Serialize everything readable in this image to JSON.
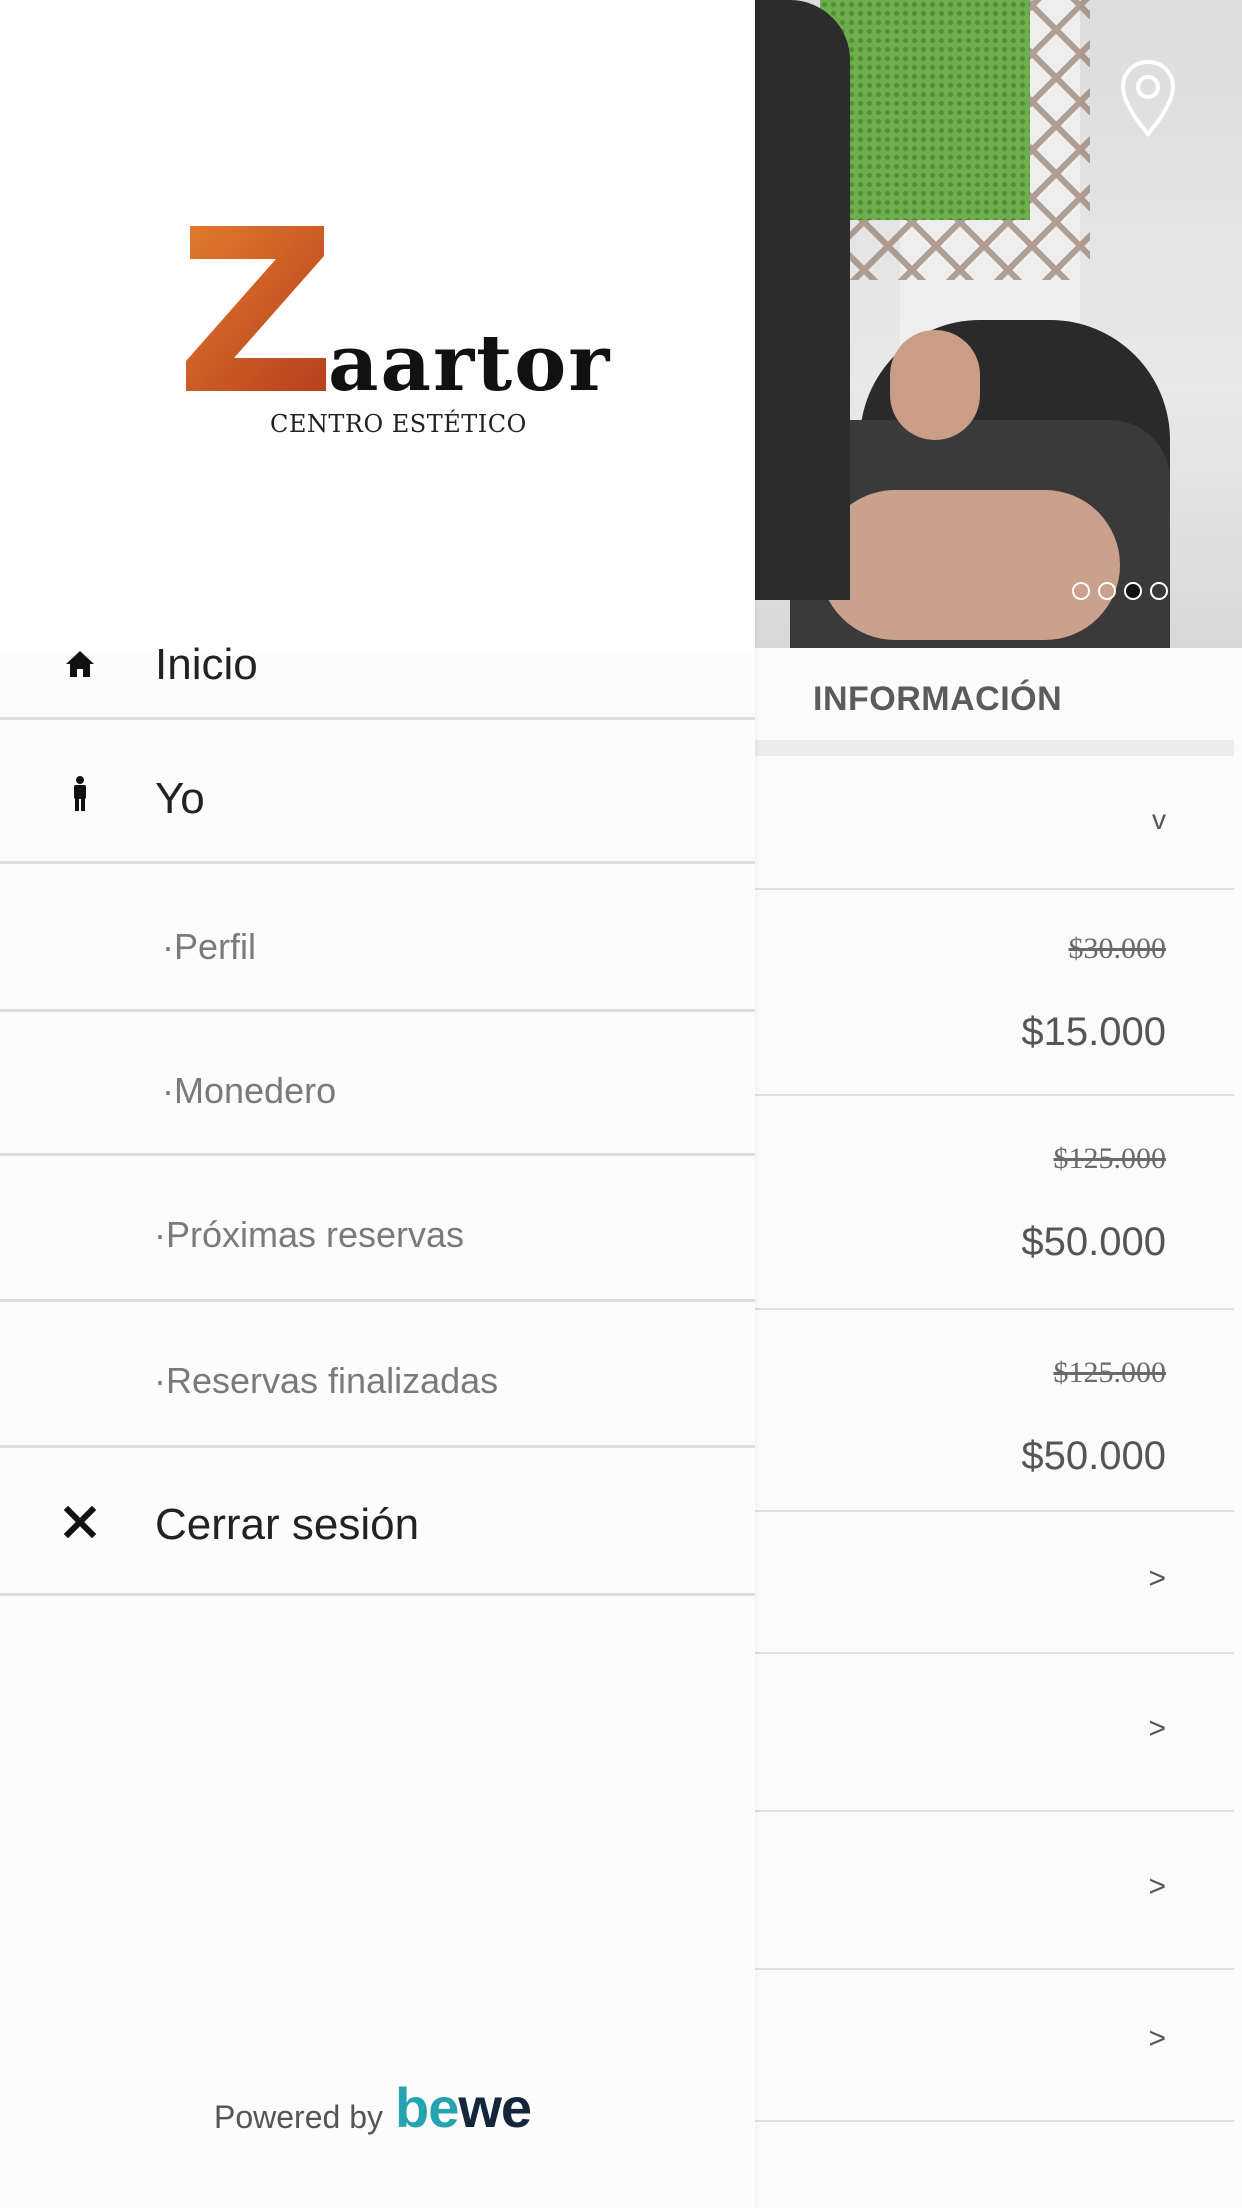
{
  "menu": {
    "items": [
      {
        "icon": "home-icon",
        "label": "Inicio"
      },
      {
        "icon": "person-icon",
        "label": "Yo"
      }
    ],
    "subitems": [
      "·Perfil",
      "·Monedero",
      "·Próximas reservas",
      "·Reservas finalizadas"
    ],
    "logout": {
      "icon": "close-icon",
      "label": "Cerrar sesión"
    }
  },
  "logo": {
    "word": "aartor",
    "subtitle": "CENTRO ESTÉTICO",
    "letter": "Z"
  },
  "powered_by": {
    "text": "Powered by",
    "brand_b": "be",
    "brand_w": "we"
  },
  "background": {
    "section_title": "INFORMACIÓN",
    "carousel": {
      "count": 4,
      "active_index": 2
    },
    "services": [
      {
        "old_price": "$30.000",
        "price": "$15.000"
      },
      {
        "old_price": "$125.000",
        "price": "$50.000"
      },
      {
        "old_price": "$125.000",
        "price": "$50.000"
      }
    ],
    "dropdown_symbol": "v",
    "row_arrow": ">"
  },
  "colors": {
    "logo_orange": "#d2582a",
    "brand_teal": "#26a3b0",
    "brand_navy": "#13263a"
  }
}
